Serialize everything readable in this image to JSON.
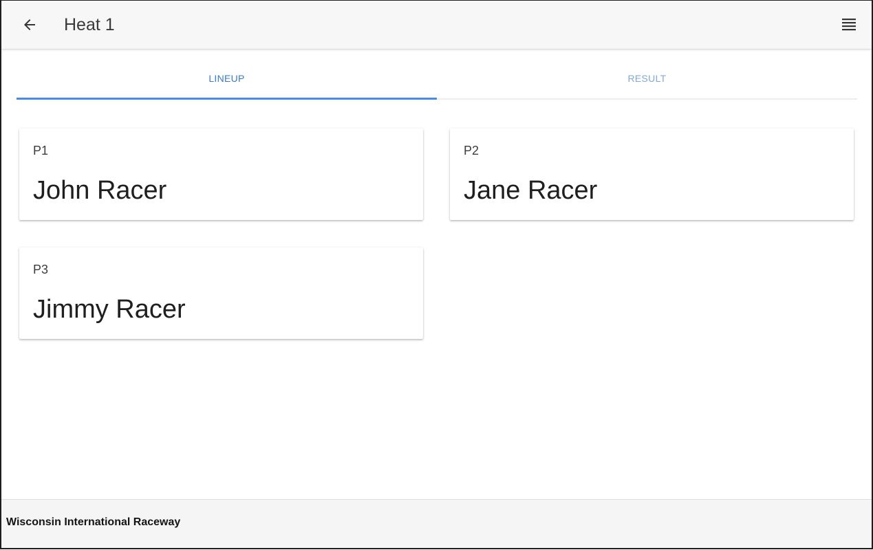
{
  "header": {
    "title": "Heat 1",
    "back_icon": "arrow-left-icon",
    "menu_icon": "menu-lines-icon"
  },
  "tabs": [
    {
      "label": "LINEUP",
      "active": true
    },
    {
      "label": "RESULT",
      "active": false
    }
  ],
  "lineup": [
    {
      "position": "P1",
      "name": "John Racer"
    },
    {
      "position": "P2",
      "name": "Jane Racer"
    },
    {
      "position": "P3",
      "name": "Jimmy Racer"
    }
  ],
  "footer": {
    "text": "Wisconsin International Raceway"
  },
  "colors": {
    "accent": "#4a8ae8",
    "active_tab_text": "#3a7bd5",
    "inactive_tab_text": "#80a8dc"
  }
}
